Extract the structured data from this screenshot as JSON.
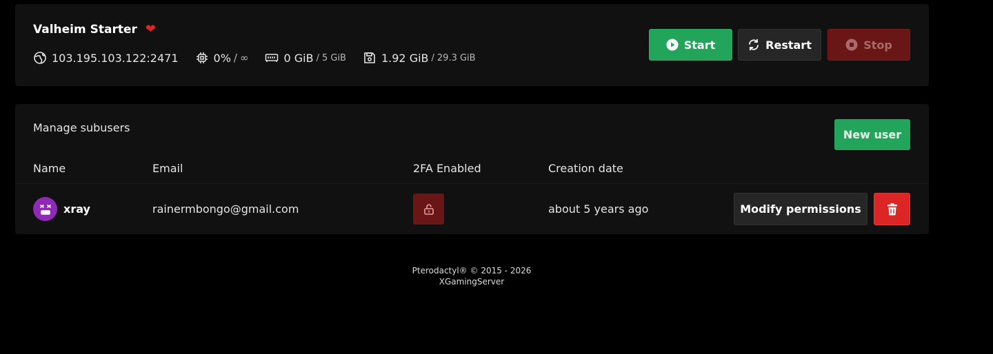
{
  "server": {
    "name": "Valheim Starter",
    "favorite_icon": "heart-icon",
    "address": "103.195.103.122:2471",
    "cpu": {
      "used": "0%",
      "separator": "/",
      "limit": "∞"
    },
    "memory": {
      "used": "0 GiB",
      "separator": "/",
      "limit": "5 GiB"
    },
    "disk": {
      "used": "1.92 GiB",
      "separator": "/",
      "limit": "29.3 GiB"
    },
    "buttons": {
      "start": "Start",
      "restart": "Restart",
      "stop": "Stop"
    }
  },
  "subusers": {
    "title": "Manage subusers",
    "new_user_label": "New user",
    "columns": [
      "Name",
      "Email",
      "2FA Enabled",
      "Creation date"
    ],
    "rows": [
      {
        "name": "xray",
        "email": "rainermbongo@gmail.com",
        "two_factor_enabled": false,
        "created": "about 5 years ago",
        "modify_label": "Modify permissions"
      }
    ]
  },
  "footer": {
    "line1": "Pterodactyl® © 2015 - 2026",
    "line2": "XGamingServer"
  },
  "colors": {
    "background": "#000000",
    "card": "#111111",
    "start": "#22a55a",
    "stop": "#6b1616",
    "delete": "#dc2626",
    "avatar": "#8e2ab5",
    "heart": "#e02424"
  }
}
